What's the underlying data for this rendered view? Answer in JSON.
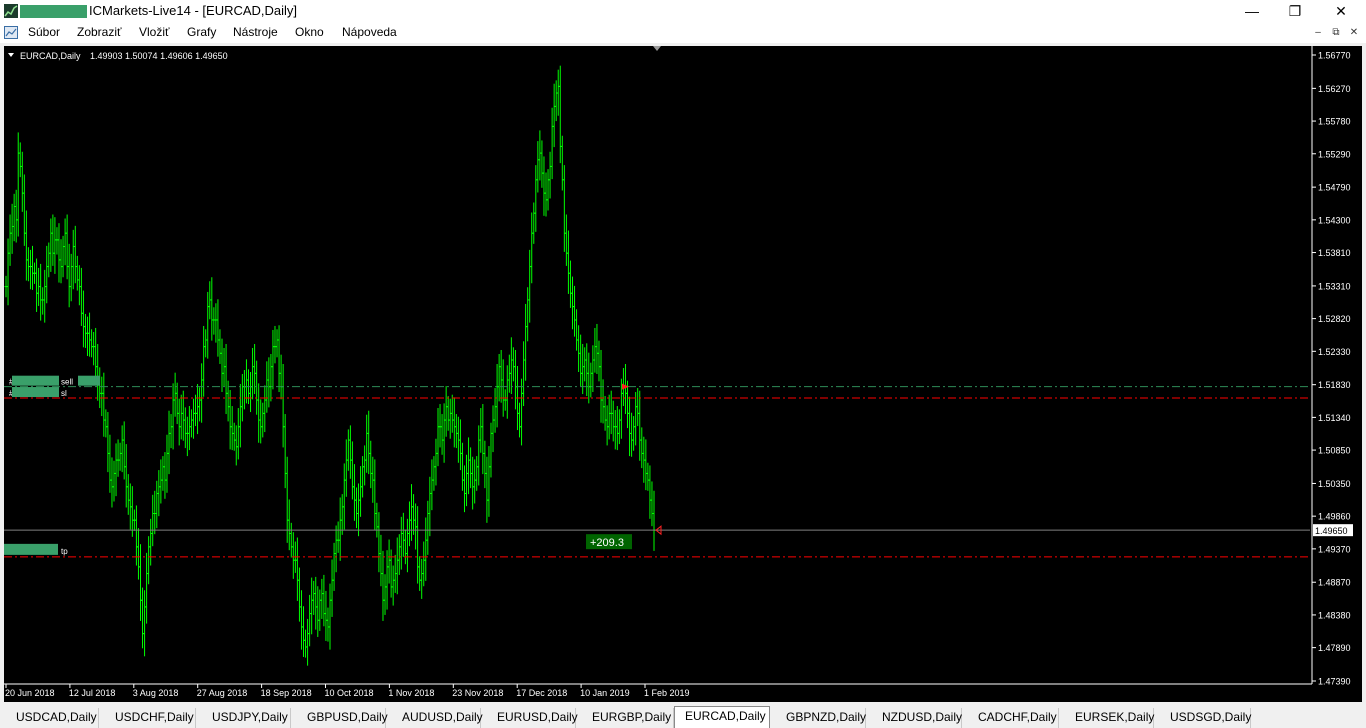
{
  "window": {
    "title": "ICMarkets-Live14 - [EURCAD,Daily]",
    "minimize_label": "—",
    "maximize_label": "❐",
    "close_label": "✕"
  },
  "menu": {
    "items": [
      "Súbor",
      "Zobraziť",
      "Vložiť",
      "Grafy",
      "Nástroje",
      "Okno",
      "Nápoveda"
    ]
  },
  "chart": {
    "header": "EURCAD,Daily",
    "ohlc": "1.49903 1.50074 1.49606 1.49650",
    "current_price": "1.49650",
    "profit_label": "+209.3",
    "order_labels": {
      "sell": "sell",
      "sl": "sl",
      "tp": "tp",
      "hash": "#"
    },
    "colors": {
      "bull": "#00ff00",
      "sell_line": "#2e8b57",
      "sl_tp_line": "#ff0000",
      "bg": "#000000",
      "profit_bg": "#006400",
      "redacted": "#3aa06a"
    }
  },
  "chart_data": {
    "type": "line",
    "symbol": "EURCAD",
    "timeframe": "Daily",
    "y_ticks": [
      "1.56770",
      "1.56270",
      "1.55780",
      "1.55290",
      "1.54790",
      "1.54300",
      "1.53810",
      "1.53310",
      "1.52820",
      "1.52330",
      "1.51830",
      "1.51340",
      "1.50850",
      "1.50350",
      "1.49860",
      "1.49370",
      "1.48870",
      "1.48380",
      "1.47890",
      "1.47390"
    ],
    "x_ticks": [
      "20 Jun 2018",
      "12 Jul 2018",
      "3 Aug 2018",
      "27 Aug 2018",
      "18 Sep 2018",
      "10 Oct 2018",
      "1 Nov 2018",
      "23 Nov 2018",
      "17 Dec 2018",
      "10 Jan 2019",
      "1 Feb 2019"
    ],
    "ylim": [
      1.4739,
      1.5677
    ],
    "levels": {
      "sell": 1.518,
      "sl": 1.5163,
      "tp": 1.4925,
      "current": 1.4965
    },
    "series": [
      {
        "values": [
          1.533,
          1.538,
          1.541,
          1.542,
          1.545,
          1.543,
          1.553,
          1.551,
          1.547,
          1.541,
          1.537,
          1.536,
          1.536,
          1.535,
          1.535,
          1.532,
          1.533,
          1.531,
          1.531,
          1.533,
          1.536,
          1.538,
          1.541,
          1.538,
          1.54,
          1.54,
          1.537,
          1.536,
          1.539,
          1.541,
          1.536,
          1.533,
          1.536,
          1.539,
          1.536,
          1.534,
          1.533,
          1.529,
          1.527,
          1.526,
          1.526,
          1.525,
          1.524,
          1.524,
          1.521,
          1.519,
          1.517,
          1.517,
          1.513,
          1.512,
          1.508,
          1.504,
          1.503,
          1.505,
          1.507,
          1.507,
          1.508,
          1.51,
          1.506,
          1.503,
          1.501,
          1.5,
          1.498,
          1.498,
          1.494,
          1.491,
          1.486,
          1.481,
          1.485,
          1.49,
          1.494,
          1.496,
          1.499,
          1.499,
          1.502,
          1.503,
          1.504,
          1.506,
          1.504,
          1.508,
          1.511,
          1.512,
          1.516,
          1.517,
          1.514,
          1.512,
          1.514,
          1.513,
          1.511,
          1.511,
          1.512,
          1.513,
          1.514,
          1.514,
          1.515,
          1.516,
          1.519,
          1.524,
          1.525,
          1.53,
          1.531,
          1.528,
          1.528,
          1.528,
          1.525,
          1.523,
          1.52,
          1.521,
          1.517,
          1.515,
          1.512,
          1.511,
          1.51,
          1.509,
          1.512,
          1.515,
          1.518,
          1.518,
          1.519,
          1.517,
          1.518,
          1.521,
          1.52,
          1.516,
          1.513,
          1.512,
          1.514,
          1.516,
          1.519,
          1.518,
          1.521,
          1.524,
          1.524,
          1.525,
          1.52,
          1.518,
          1.512,
          1.505,
          1.498,
          1.496,
          1.494,
          1.492,
          1.492,
          1.489,
          1.485,
          1.482,
          1.48,
          1.479,
          1.481,
          1.484,
          1.486,
          1.487,
          1.485,
          1.483,
          1.486,
          1.487,
          1.484,
          1.483,
          1.482,
          1.486,
          1.489,
          1.493,
          1.495,
          1.495,
          1.498,
          1.5,
          1.504,
          1.507,
          1.51,
          1.507,
          1.503,
          1.501,
          1.499,
          1.501,
          1.503,
          1.506,
          1.507,
          1.511,
          1.508,
          1.505,
          1.504,
          1.499,
          1.497,
          1.493,
          1.49,
          1.486,
          1.488,
          1.491,
          1.492,
          1.488,
          1.489,
          1.49,
          1.492,
          1.494,
          1.496,
          1.495,
          1.493,
          1.496,
          1.498,
          1.5,
          1.498,
          1.497,
          1.491,
          1.489,
          1.49,
          1.492,
          1.495,
          1.499,
          1.502,
          1.504,
          1.506,
          1.508,
          1.512,
          1.512,
          1.51,
          1.513,
          1.515,
          1.513,
          1.514,
          1.513,
          1.512,
          1.511,
          1.51,
          1.508,
          1.504,
          1.502,
          1.505,
          1.507,
          1.505,
          1.503,
          1.504,
          1.506,
          1.51,
          1.512,
          1.508,
          1.505,
          1.501,
          1.506,
          1.511,
          1.513,
          1.515,
          1.518,
          1.521,
          1.519,
          1.516,
          1.516,
          1.519,
          1.52,
          1.522,
          1.521,
          1.518,
          1.514,
          1.512,
          1.517,
          1.522,
          1.527,
          1.531,
          1.536,
          1.541,
          1.544,
          1.549,
          1.552,
          1.553,
          1.55,
          1.547,
          1.546,
          1.549,
          1.551,
          1.557,
          1.56,
          1.562,
          1.563,
          1.554,
          1.549,
          1.541,
          1.538,
          1.535,
          1.532,
          1.53,
          1.528,
          1.525,
          1.523,
          1.52,
          1.521,
          1.522,
          1.52,
          1.518,
          1.52,
          1.522,
          1.524,
          1.523,
          1.521,
          1.516,
          1.515,
          1.513,
          1.512,
          1.514,
          1.514,
          1.512,
          1.512,
          1.511,
          1.513,
          1.517,
          1.518,
          1.517,
          1.514,
          1.511,
          1.51,
          1.512,
          1.515,
          1.514,
          1.51,
          1.508,
          1.507,
          1.505,
          1.504,
          1.501,
          1.499,
          1.4965
        ]
      }
    ]
  },
  "tabs": [
    "USDCAD,Daily",
    "USDCHF,Daily",
    "USDJPY,Daily",
    "GBPUSD,Daily",
    "AUDUSD,Daily",
    "EURUSD,Daily",
    "EURGBP,Daily",
    "EURCAD,Daily",
    "GBPNZD,Daily",
    "NZDUSD,Daily",
    "CADCHF,Daily",
    "EURSEK,Daily",
    "USDSGD,Daily"
  ],
  "active_tab": "EURCAD,Daily"
}
